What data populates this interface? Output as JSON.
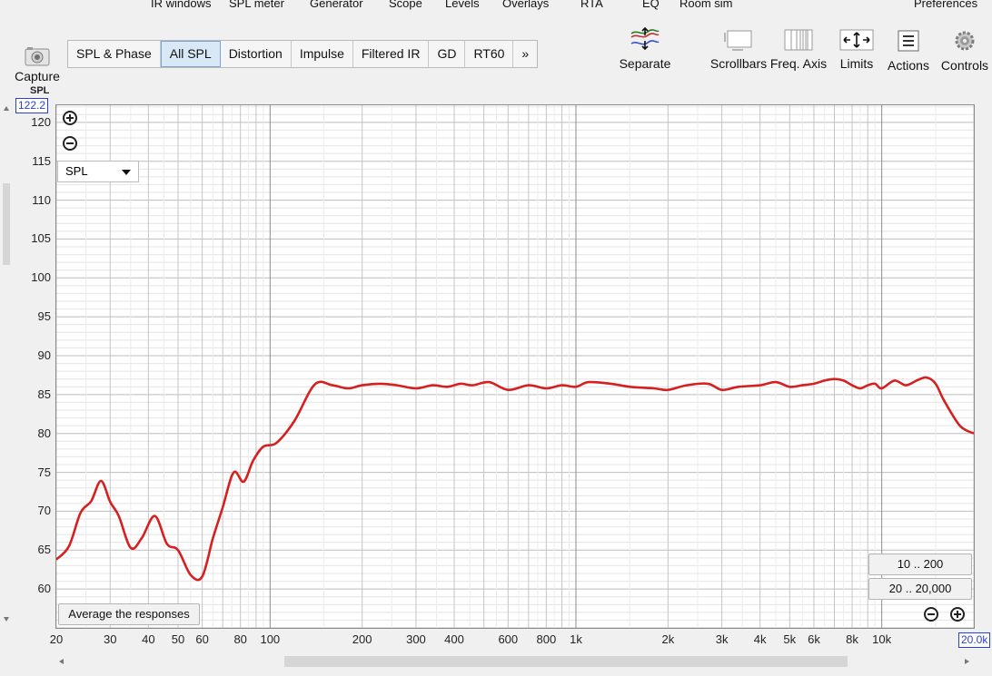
{
  "menu": [
    {
      "id": "ir-windows",
      "label": "IR windows"
    },
    {
      "id": "spl-meter",
      "label": "SPL meter"
    },
    {
      "id": "generator",
      "label": "Generator"
    },
    {
      "id": "scope",
      "label": "Scope"
    },
    {
      "id": "levels",
      "label": "Levels"
    },
    {
      "id": "overlays",
      "label": "Overlays"
    },
    {
      "id": "rta",
      "label": "RTA"
    },
    {
      "id": "eq",
      "label": "EQ"
    },
    {
      "id": "room-sim",
      "label": "Room sim"
    },
    {
      "id": "preferences",
      "label": "Preferences"
    }
  ],
  "toolbar": {
    "capture": "Capture",
    "tabs": [
      "SPL & Phase",
      "All SPL",
      "Distortion",
      "Impulse",
      "Filtered IR",
      "GD",
      "RT60",
      "»"
    ],
    "active_tab": "All SPL",
    "separate": "Separate",
    "scrollbars": "Scrollbars",
    "freq_axis": "Freq. Axis",
    "limits": "Limits",
    "actions": "Actions",
    "controls": "Controls"
  },
  "plot": {
    "y_unit": "SPL",
    "y_top_value": "122.2",
    "x_right_value": "20.0k",
    "selector": "SPL",
    "average_button": "Average the responses",
    "range_10_200": "10 .. 200",
    "range_20_20000": "20 .. 20,000",
    "curve_color": "#d62020"
  },
  "chart_data": {
    "type": "line",
    "x_scale": "log",
    "xlim": [
      20,
      20000
    ],
    "ylim": [
      55,
      122.2
    ],
    "ylabel": "SPL",
    "x_ticks": [
      20,
      30,
      40,
      50,
      60,
      80,
      100,
      200,
      300,
      400,
      600,
      800,
      1000,
      2000,
      3000,
      4000,
      5000,
      6000,
      8000,
      10000
    ],
    "x_tick_labels": [
      "20",
      "30",
      "40",
      "50",
      "60",
      "80",
      "100",
      "200",
      "300",
      "400",
      "600",
      "800",
      "1k",
      "2k",
      "3k",
      "4k",
      "5k",
      "6k",
      "8k",
      "10k"
    ],
    "y_ticks": [
      60,
      65,
      70,
      75,
      80,
      85,
      90,
      95,
      100,
      105,
      110,
      115,
      120
    ],
    "grid": true,
    "series": [
      {
        "x": [
          20,
          22,
          24,
          26,
          28,
          30,
          32,
          35,
          38,
          42,
          46,
          50,
          55,
          60,
          65,
          70,
          76,
          82,
          88,
          95,
          105,
          120,
          140,
          160,
          180,
          200,
          230,
          260,
          300,
          340,
          380,
          420,
          460,
          520,
          600,
          700,
          800,
          900,
          1000,
          1100,
          1300,
          1500,
          1800,
          2000,
          2300,
          2700,
          3000,
          3400,
          4000,
          4500,
          5000,
          5500,
          6000,
          6500,
          7000,
          7500,
          8000,
          8500,
          9000,
          9500,
          10000,
          11000,
          12000,
          13000,
          14000,
          15000,
          16000,
          18000,
          20000
        ],
        "y": [
          63.8,
          65.5,
          69.8,
          71.3,
          73.9,
          71.2,
          69.4,
          65.3,
          66.5,
          69.4,
          65.8,
          65.0,
          61.8,
          61.6,
          66.5,
          70.5,
          75.0,
          73.8,
          76.5,
          78.3,
          78.8,
          81.6,
          86.3,
          86.2,
          85.8,
          86.2,
          86.4,
          86.2,
          85.8,
          86.2,
          86.0,
          86.4,
          86.2,
          86.6,
          85.6,
          86.2,
          85.8,
          86.2,
          86.0,
          86.6,
          86.4,
          86.0,
          85.8,
          85.6,
          86.2,
          86.4,
          85.6,
          86.0,
          86.2,
          86.6,
          86.0,
          86.2,
          86.4,
          86.8,
          87.0,
          86.8,
          86.2,
          85.8,
          86.2,
          86.4,
          85.8,
          86.8,
          86.2,
          86.8,
          87.2,
          86.4,
          84.2,
          81.0,
          80.0
        ],
        "color": "#d62020"
      }
    ]
  }
}
